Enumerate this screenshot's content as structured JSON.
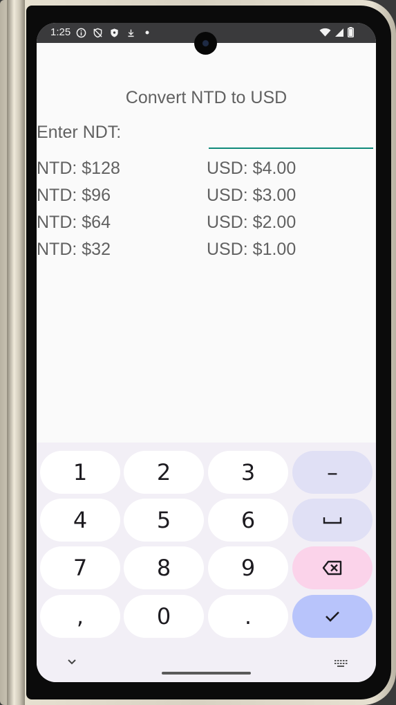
{
  "status_bar": {
    "time": "1:25",
    "left_icons": [
      "info-icon",
      "shield-off-icon",
      "shield-icon",
      "download-icon",
      "dot-icon"
    ],
    "right_icons": [
      "wifi-icon",
      "signal-icon",
      "battery-icon"
    ]
  },
  "app": {
    "title": "Convert NTD to USD",
    "input_label": "Enter NDT:",
    "input_value": "",
    "rows": [
      {
        "ntd": "NTD: $128",
        "usd": "USD: $4.00"
      },
      {
        "ntd": "NTD: $96",
        "usd": "USD: $3.00"
      },
      {
        "ntd": "NTD: $64",
        "usd": "USD: $2.00"
      },
      {
        "ntd": "NTD: $32",
        "usd": "USD: $1.00"
      }
    ]
  },
  "keyboard": {
    "keys": [
      [
        "1",
        "2",
        "3",
        "–"
      ],
      [
        "4",
        "5",
        "6",
        "␣"
      ],
      [
        "7",
        "8",
        "9",
        "⌫"
      ],
      [
        ",",
        "0",
        ".",
        "✓"
      ]
    ],
    "accent_colors": {
      "function": "#e0e0f5",
      "delete": "#fbd3ea",
      "done": "#b8c4fb"
    }
  },
  "colors": {
    "input_underline": "#0f8a7a",
    "text": "#616161"
  }
}
